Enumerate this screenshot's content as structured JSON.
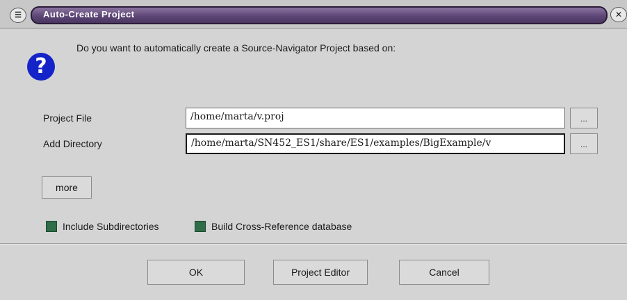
{
  "window": {
    "title": "Auto-Create Project",
    "menu_glyph": "☰",
    "close_glyph": "✕"
  },
  "dialog": {
    "icon": "help-icon",
    "icon_glyph": "?",
    "question": "Do you want to automatically create a Source-Navigator Project based on:",
    "project_file": {
      "label": "Project File",
      "value": "/home/marta/v.proj",
      "browse_label": "..."
    },
    "add_directory": {
      "label": "Add Directory",
      "value": "/home/marta/SN452_ES1/share/ES1/examples/BigExample/v",
      "browse_label": "..."
    },
    "more_label": "more",
    "options": [
      {
        "label": "Include Subdirectories",
        "checked": true
      },
      {
        "label": "Build Cross-Reference database",
        "checked": true
      }
    ]
  },
  "buttons": {
    "ok": "OK",
    "project_editor": "Project Editor",
    "cancel": "Cancel"
  },
  "colors": {
    "title_bar": "#5d4676",
    "help_icon": "#1424c8",
    "checkbox": "#2f6d48",
    "background": "#d4d4d4"
  }
}
